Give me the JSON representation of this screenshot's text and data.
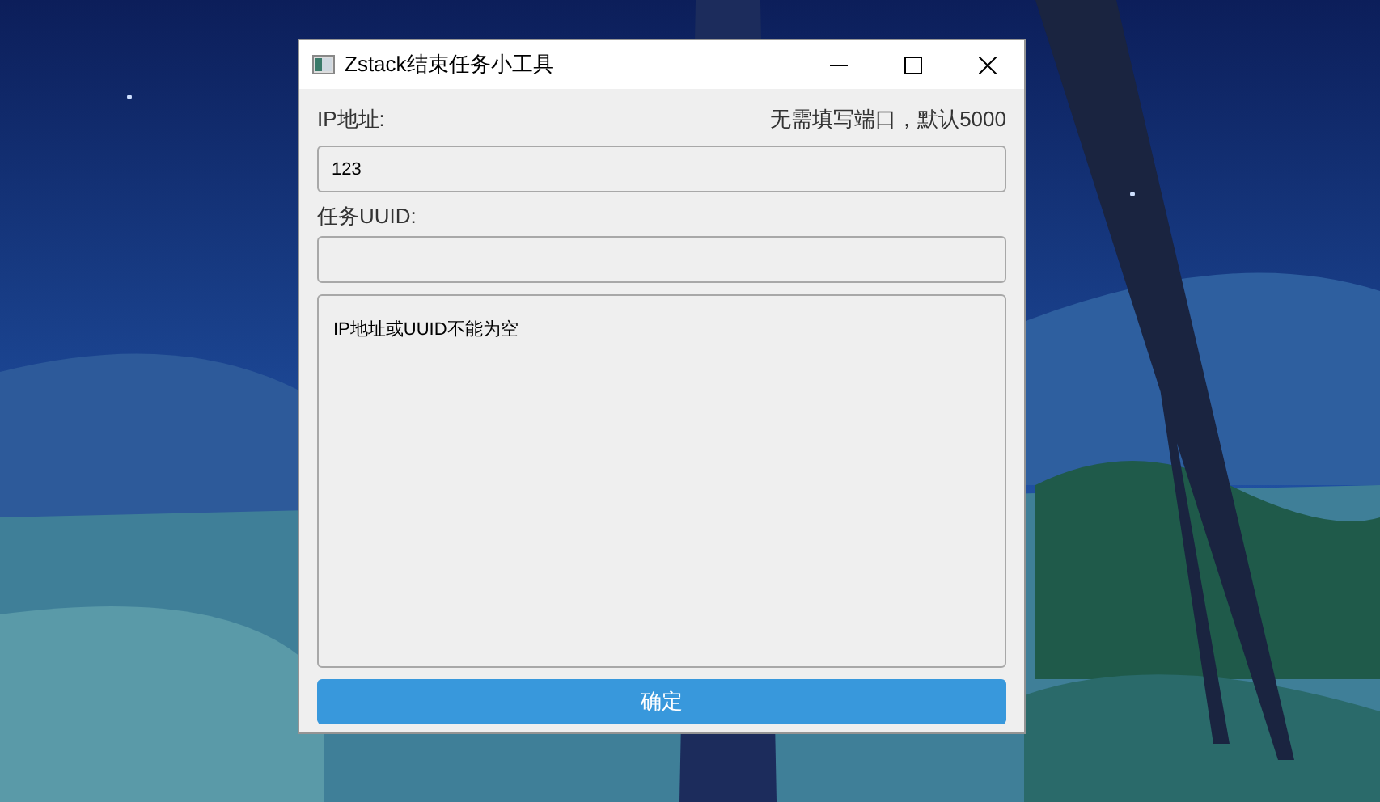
{
  "window": {
    "title": "Zstack结束任务小工具"
  },
  "ip": {
    "label": "IP地址:",
    "hint": "无需填写端口，默认5000",
    "value": "123"
  },
  "uuid": {
    "label": "任务UUID:"
  },
  "output": {
    "value": "IP地址或UUID不能为空"
  },
  "buttons": [
    "确定"
  ]
}
